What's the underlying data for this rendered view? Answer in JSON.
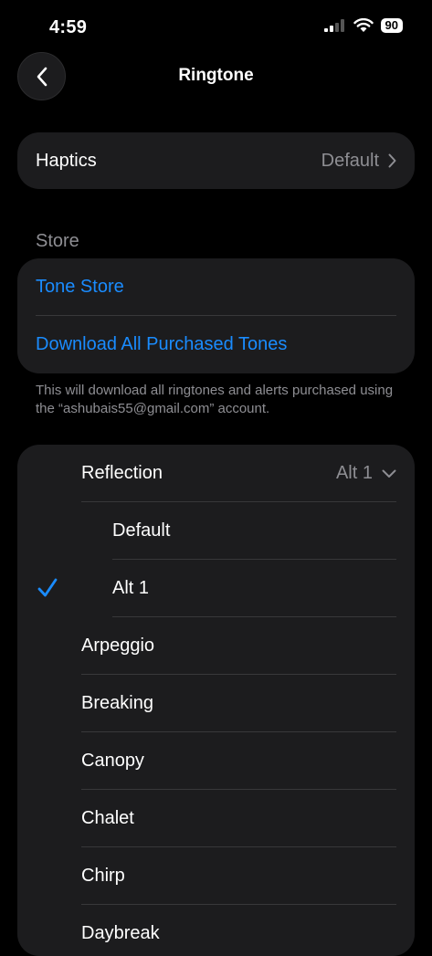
{
  "status_bar": {
    "time": "4:59",
    "battery": "90"
  },
  "nav": {
    "title": "Ringtone"
  },
  "haptics": {
    "label": "Haptics",
    "value": "Default"
  },
  "store": {
    "header": "Store",
    "tone_store": "Tone Store",
    "download_all": "Download All Purchased Tones",
    "note": "This will download all ringtones and alerts purchased using the “ashubais55@gmail.com” account."
  },
  "tones": {
    "group": {
      "label": "Reflection",
      "value": "Alt 1"
    },
    "variants": [
      {
        "label": "Default",
        "selected": false
      },
      {
        "label": "Alt 1",
        "selected": true
      }
    ],
    "items": [
      "Arpeggio",
      "Breaking",
      "Canopy",
      "Chalet",
      "Chirp",
      "Daybreak"
    ]
  },
  "colors": {
    "accent": "#1a8cff",
    "background": "#000000",
    "card": "#1c1c1e",
    "secondary_text": "#8e8e93"
  }
}
